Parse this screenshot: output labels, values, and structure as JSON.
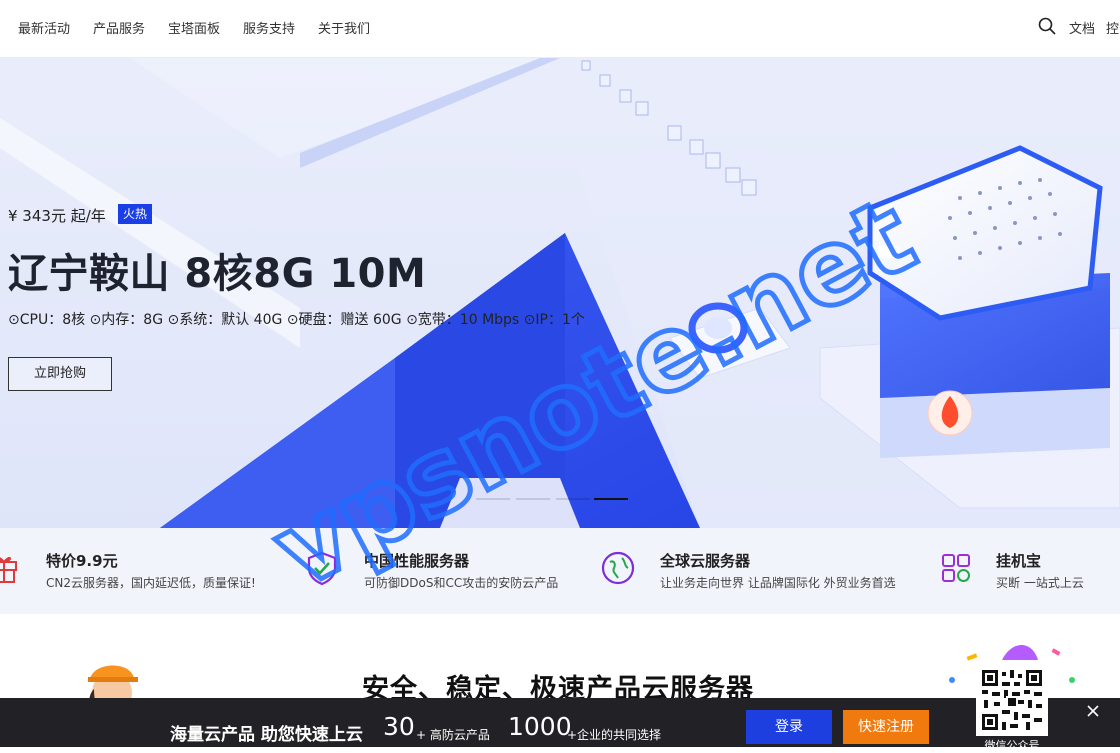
{
  "nav": {
    "items": [
      "最新活动",
      "产品服务",
      "宝塔面板",
      "服务支持",
      "关于我们"
    ],
    "right": [
      "文档",
      "控"
    ]
  },
  "hero": {
    "price": "¥ 343元 起/年",
    "badge": "火热",
    "title": "辽宁鞍山 8核8G 10M",
    "specs": "⊙CPU：8核 ⊙内存：8G ⊙系统：默认 40G ⊙硬盘：赠送 60G ⊙宽带：10 Mbps ⊙IP：1个",
    "button": "立即抢购",
    "carousel_total": 4,
    "carousel_active": 4
  },
  "features": [
    {
      "title": "特价9.9元",
      "desc": "CN2云服务器，国内延迟低，质量保证!",
      "icon": "gift-icon",
      "color": "#e03a3a"
    },
    {
      "title": "中国性能服务器",
      "desc": "可防御DDoS和CC攻击的安防云产品",
      "icon": "shield-check-icon",
      "color": "#8a2be2"
    },
    {
      "title": "全球云服务器",
      "desc": "让业务走向世界 让品牌国际化 外贸业务首选",
      "icon": "globe-icon",
      "color": "#7b2fd6"
    },
    {
      "title": "挂机宝",
      "desc": "买断 一站式上云",
      "icon": "apps-grid-icon",
      "color": "#9b2fd6"
    }
  ],
  "section": {
    "title": "安全、稳定、极速产品云服务器"
  },
  "bottom_bar": {
    "slogan": "海量云产品 助您快速上云",
    "stat1_num": "30",
    "stat1_label": "+ 高防云产品",
    "stat2_num": "1000",
    "stat2_label": "+企业的共同选择",
    "login": "登录",
    "register": "快速注册",
    "qr_label": "微信公众号"
  },
  "watermark": "vpsnote.net",
  "colors": {
    "brand_blue": "#1d3fe0",
    "orange": "#f07a0e",
    "bar_bg": "#222226"
  }
}
